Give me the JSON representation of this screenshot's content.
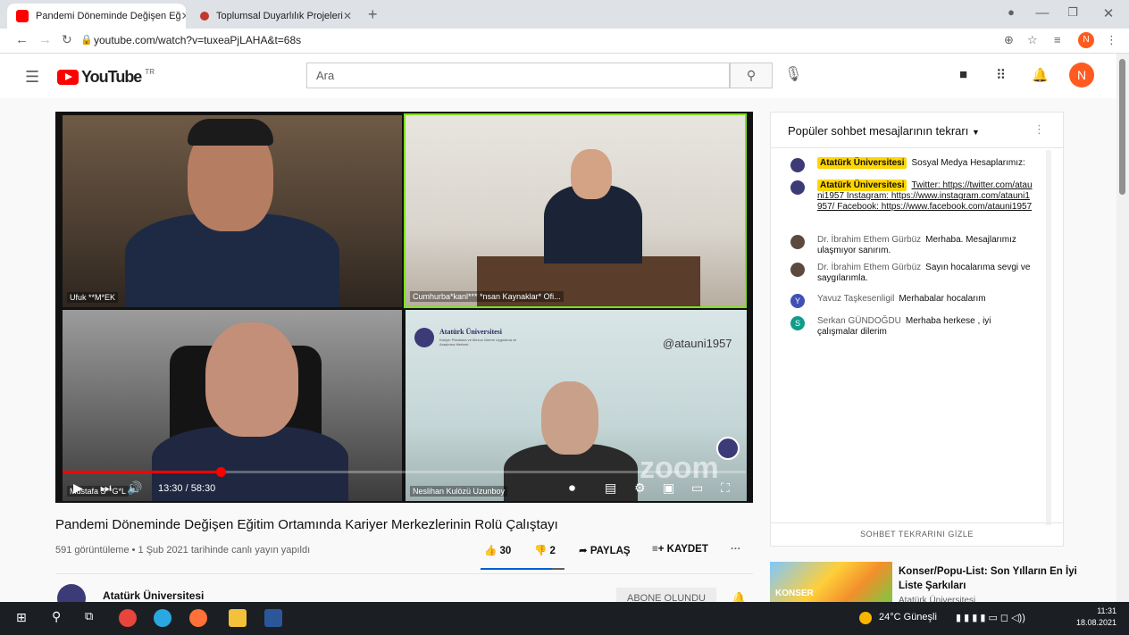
{
  "browser": {
    "tabs": [
      {
        "title": "Pandemi Döneminde Değişen Eğ",
        "close": "✕",
        "active": true
      },
      {
        "title": "Toplumsal Duyarlılık Projeleri",
        "close": "✕",
        "active": false
      }
    ],
    "new_tab": "+",
    "url": "youtube.com/watch?v=tuxeaPjLAHA&t=68s",
    "avatar_letter": "N"
  },
  "youtube": {
    "logo_word": "YouTube",
    "logo_region": "TR",
    "search_placeholder": "Ara",
    "avatar_letter": "N"
  },
  "video": {
    "participants": [
      {
        "name": "Ufuk **M*EK"
      },
      {
        "name": "Cumhurba*kanl*** *nsan Kaynaklar* Ofi..."
      },
      {
        "name": "Mustafa S**G*L"
      },
      {
        "name": "Neslihan Kulözü Uzunboy"
      }
    ],
    "slide_brand": "Atatürk Üniversitesi",
    "slide_sub": "Kariyer Planlama ve Mezun İzleme Uygulama ve Araştırma Merkezi",
    "slide_handle": "@atauni1957",
    "watermark": "zoom",
    "time_current": "13:30",
    "time_total": "58:30",
    "time_display": "13:30 / 58:30",
    "progress": 0.231
  },
  "title": "Pandemi Döneminde Değişen Eğitim Ortamında Kariyer Merkezlerinin Rolü Çalıştayı",
  "meta": "591 görüntüleme • 1 Şub 2021 tarihinde canlı yayın yapıldı",
  "actions": {
    "likes": "30",
    "dislikes": "2",
    "share": "PAYLAŞ",
    "save": "KAYDET",
    "more": "···"
  },
  "channel": {
    "name": "Atatürk Üniversitesi",
    "subscribe": "ABONE OLUNDU"
  },
  "chat": {
    "header": "Popüler sohbet mesajlarının tekrarı",
    "messages": [
      {
        "author": "Atatürk Üniversitesi",
        "owner": true,
        "text": "Sosyal Medya Hesaplarımız:"
      },
      {
        "author": "Atatürk Üniversitesi",
        "owner": true,
        "text": "Twitter: https://twitter.com/atauni1957 Instagram: https://www.instagram.com/atauni1957/ Facebook: https://www.facebook.com/atauni1957"
      },
      {
        "author": "Dr. İbrahim Ethem Gürbüz",
        "owner": false,
        "text": "Merhaba. Mesajlarımız ulaşmıyor sanırım."
      },
      {
        "author": "Dr. İbrahim Ethem Gürbüz",
        "owner": false,
        "text": "Sayın hocalarıma sevgi ve saygılarımla."
      },
      {
        "author": "Yavuz Taşkesenligil",
        "owner": false,
        "avatar_letter": "Y",
        "text": "Merhabalar hocalarım"
      },
      {
        "author": "Serkan GÜNDOĞDU",
        "owner": false,
        "avatar_letter": "S",
        "text": "Merhaba herkese , iyi çalışmalar dilerim"
      }
    ],
    "footer": "SOHBET TEKRARINI GİZLE"
  },
  "recommended": {
    "title": "Konser/Popu-List: Son Yılların En İyi Liste Şarkıları",
    "channel": "Atatürk Üniversitesi",
    "thumb_text": "KONSER"
  },
  "taskbar": {
    "weather": "24°C Güneşli",
    "time": "11:31",
    "date": "18.08.2021"
  },
  "colors": {
    "youtube_red": "#ff0000",
    "active_speaker": "#7ee11c",
    "owner_badge": "#ffd600",
    "like_blue": "#065fd4",
    "avatar_orange": "#ff5a1f"
  }
}
